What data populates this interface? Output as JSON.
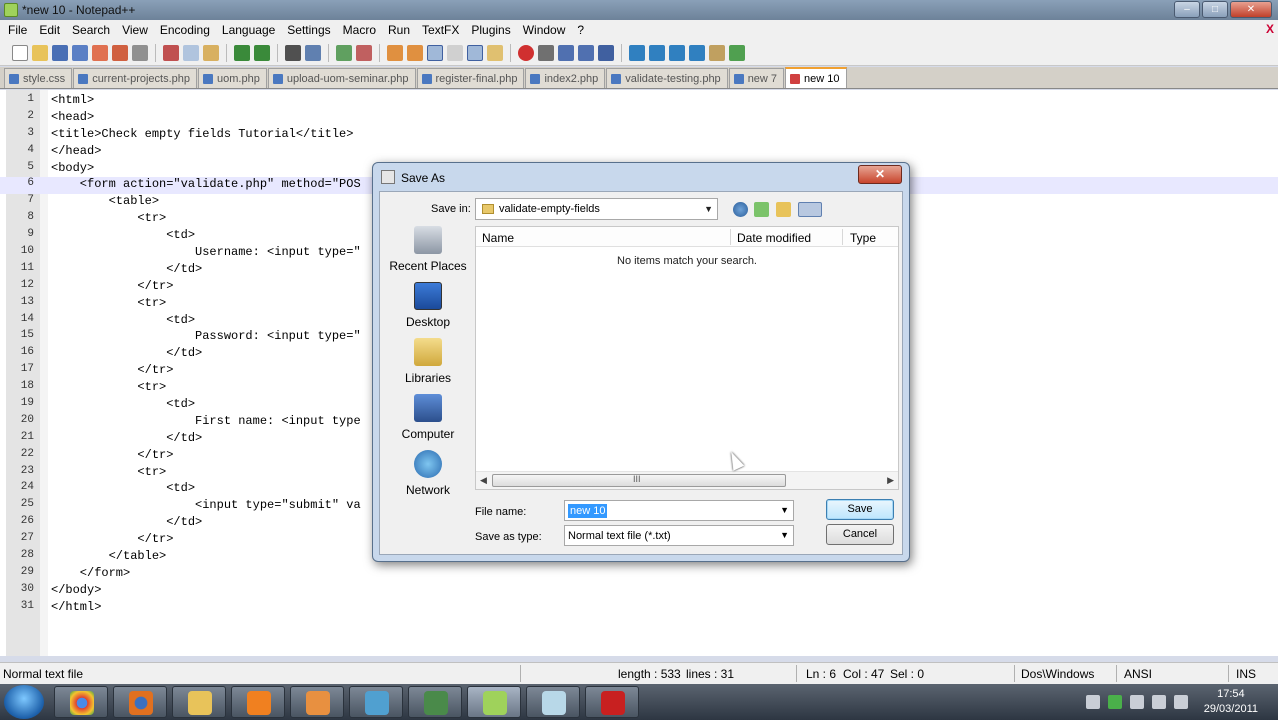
{
  "window": {
    "title": "*new  10 - Notepad++"
  },
  "menu": [
    "File",
    "Edit",
    "Search",
    "View",
    "Encoding",
    "Language",
    "Settings",
    "Macro",
    "Run",
    "TextFX",
    "Plugins",
    "Window",
    "?"
  ],
  "menu_close": "X",
  "tabs": [
    {
      "label": "style.css",
      "active": false
    },
    {
      "label": "current-projects.php",
      "active": false
    },
    {
      "label": "uom.php",
      "active": false
    },
    {
      "label": "upload-uom-seminar.php",
      "active": false
    },
    {
      "label": "register-final.php",
      "active": false
    },
    {
      "label": "index2.php",
      "active": false
    },
    {
      "label": "validate-testing.php",
      "active": false
    },
    {
      "label": "new  7",
      "active": false
    },
    {
      "label": "new  10",
      "active": true
    }
  ],
  "editor": {
    "current_line": 6,
    "lines": [
      "<html>",
      "<head>",
      "<title>Check empty fields Tutorial</title>",
      "</head>",
      "<body>",
      "    <form action=\"validate.php\" method=\"POS",
      "        <table>",
      "            <tr>",
      "                <td>",
      "                    Username: <input type=\"",
      "                </td>",
      "            </tr>",
      "            <tr>",
      "                <td>",
      "                    Password: <input type=\"",
      "                </td>",
      "            </tr>",
      "            <tr>",
      "                <td>",
      "                    First name: <input type",
      "                </td>",
      "            </tr>",
      "            <tr>",
      "                <td>",
      "                    <input type=\"submit\" va",
      "                </td>",
      "            </tr>",
      "        </table>",
      "    </form>",
      "</body>",
      "</html>"
    ]
  },
  "status": {
    "file_type": "Normal text file",
    "length": "length : 533",
    "lines": "lines : 31",
    "ln": "Ln : 6",
    "col": "Col : 47",
    "sel": "Sel : 0",
    "eol": "Dos\\Windows",
    "encoding": "ANSI",
    "mode": "INS"
  },
  "dialog": {
    "title": "Save As",
    "save_in_label": "Save in:",
    "save_in_value": "validate-empty-fields",
    "places": [
      "Recent Places",
      "Desktop",
      "Libraries",
      "Computer",
      "Network"
    ],
    "columns": [
      "Name",
      "Date modified",
      "Type"
    ],
    "empty_message": "No items match your search.",
    "scroll_grip": "III",
    "file_name_label": "File name:",
    "file_name_value": "new  10",
    "save_type_label": "Save as type:",
    "save_type_value": "Normal text file (*.txt)",
    "save_button": "Save",
    "cancel_button": "Cancel",
    "close_glyph": "✕"
  },
  "taskbar": {
    "time": "17:54",
    "date": "29/03/2011"
  },
  "colors": {
    "current_line": "#e8e8ff",
    "active_tab_accent": "#f0a030",
    "selection": "#3399ff"
  }
}
